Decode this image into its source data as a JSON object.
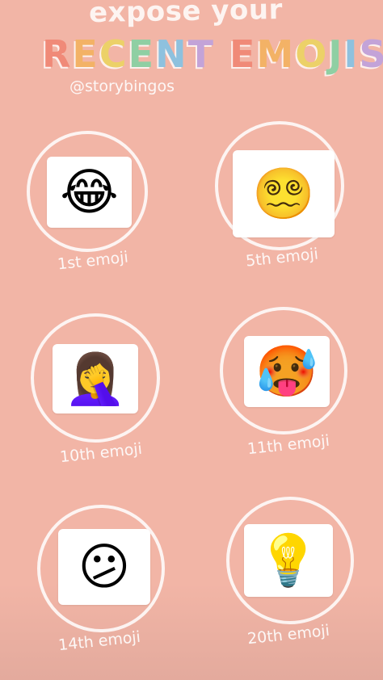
{
  "header": {
    "tagline": "expose your",
    "title_letters": [
      "R",
      "E",
      "C",
      "E",
      "N",
      "T",
      " ",
      "E",
      "M",
      "O",
      "J",
      "I",
      "S"
    ],
    "title_colors": [
      "#f08a78",
      "#f3b266",
      "#ecd168",
      "#8fcfa3",
      "#8ec1de",
      "#c3a3d8",
      "#ffffff",
      "#f08a78",
      "#f3b266",
      "#ecd168",
      "#8fcfa3",
      "#8ec1de",
      "#c3a3d8"
    ],
    "handle": "@storybingos"
  },
  "slots": [
    {
      "label": "1st emoji",
      "emoji": "😂",
      "icon": "face-with-tears-of-joy-icon"
    },
    {
      "label": "5th emoji",
      "emoji": "😵‍💫",
      "icon": "face-with-spiral-eyes-icon"
    },
    {
      "label": "10th emoji",
      "emoji": "🤦‍♀️",
      "icon": "woman-facepalming-icon"
    },
    {
      "label": "11th emoji",
      "emoji": "🥵",
      "icon": "hot-face-icon"
    },
    {
      "label": "14th emoji",
      "emoji": "😕",
      "icon": "confused-face-icon"
    },
    {
      "label": "20th emoji",
      "emoji": "💡",
      "icon": "light-bulb-icon"
    }
  ],
  "colors": {
    "background": "#f2b5a6",
    "ring": "#ffffff",
    "card": "#ffffff"
  }
}
